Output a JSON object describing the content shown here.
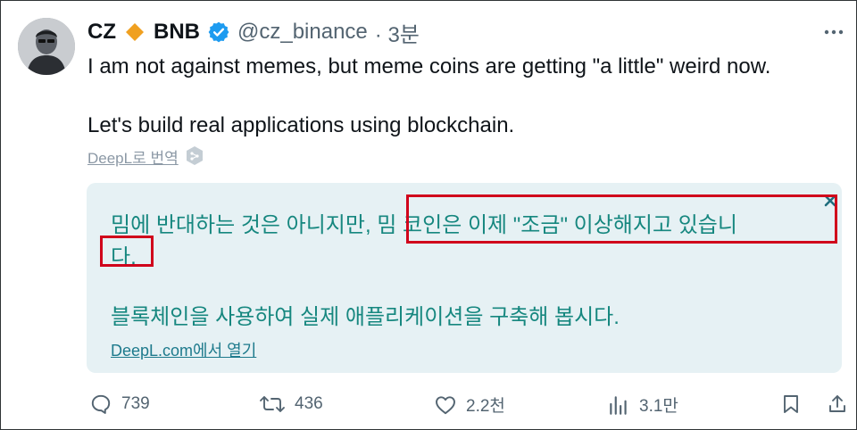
{
  "tweet": {
    "author_name": "CZ",
    "author_name_suffix": "BNB",
    "handle": "@cz_binance",
    "time": "· 3분",
    "text_line1": "I am not against memes, but meme coins are getting \"a little\" weird now.",
    "text_line2": "Let's build real applications using blockchain.",
    "translate_link": "DeepL로 번역",
    "more_icon": "ellipsis-icon"
  },
  "translation": {
    "line1": "밈에 반대하는 것은 아니지만, 밈 코인은 이제 \"조금\" 이상해지고 있습니",
    "line2": "다.",
    "line3": "블록체인을 사용하여 실제 애플리케이션을 구축해 봅시다.",
    "open_link": "DeepL.com에서 열기",
    "text_color": "#16877f",
    "bg_color": "#e6f1f4"
  },
  "highlight_color": "#d0021b",
  "actions": {
    "replies": "739",
    "retweets": "436",
    "likes": "2.2천",
    "views": "3.1만"
  },
  "colors": {
    "verified_blue": "#1d9bf0",
    "bnb_orange": "#f0a020",
    "secondary_text": "#536471"
  }
}
